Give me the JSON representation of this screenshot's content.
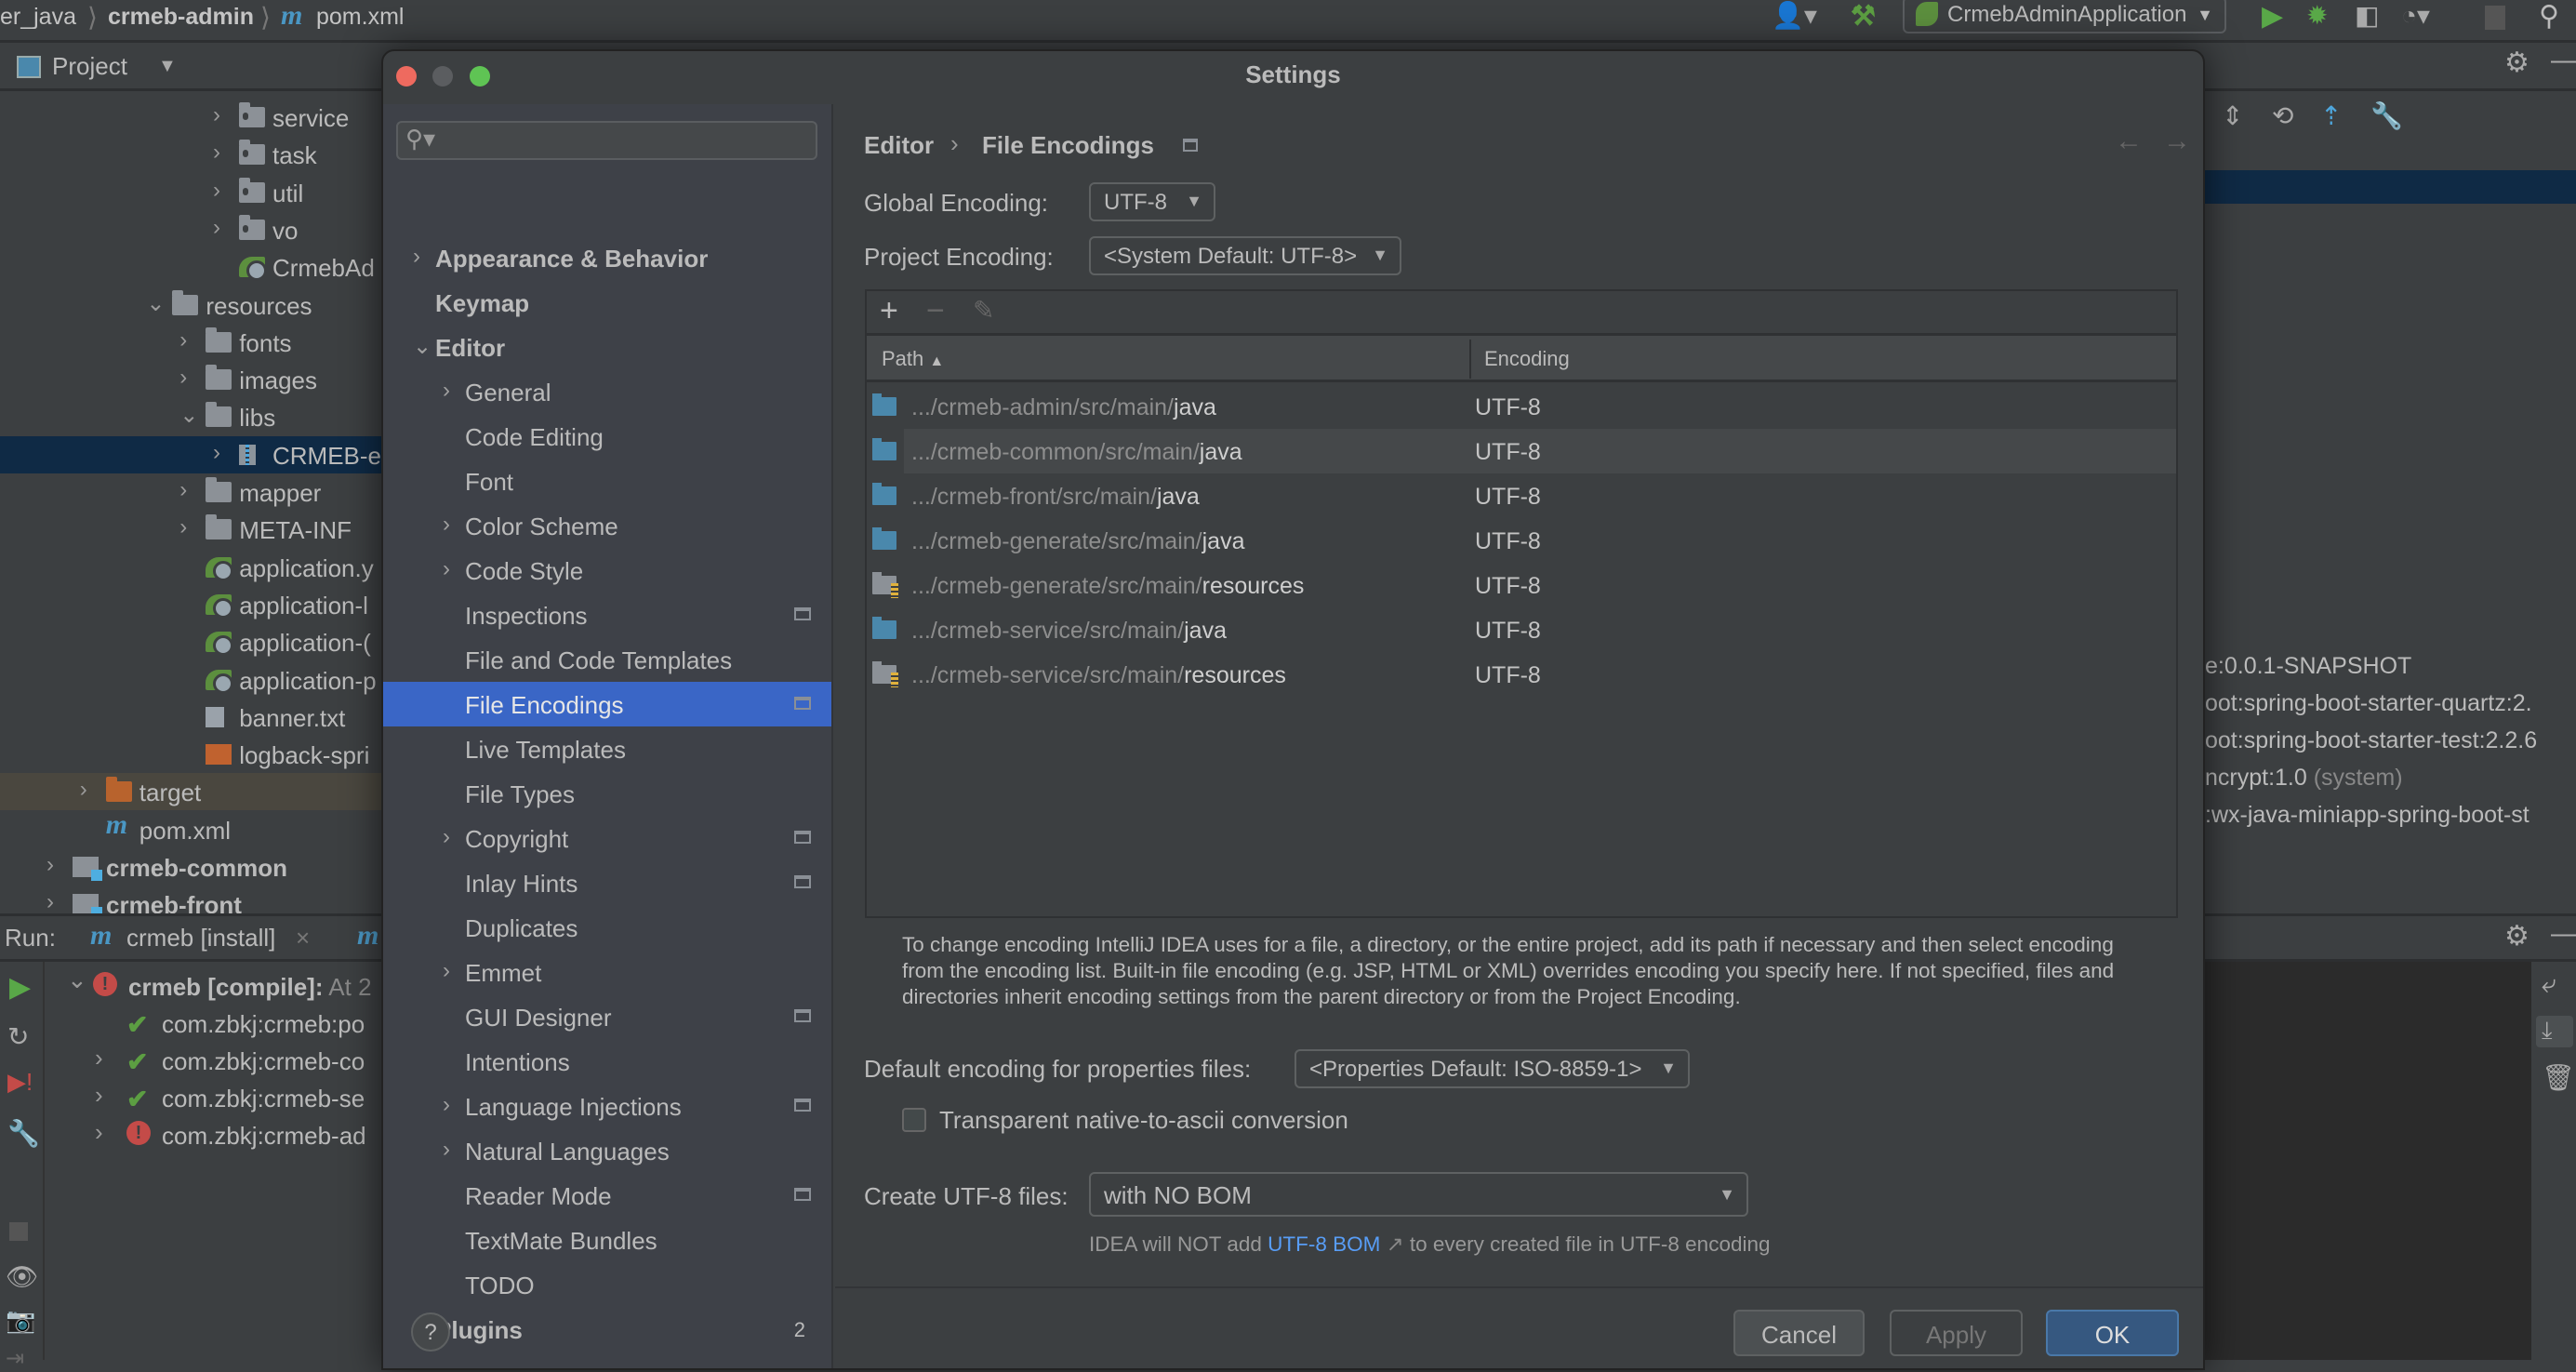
{
  "toolbar": {
    "breadcrumb": [
      "er_java",
      "crmeb-admin",
      "pom.xml"
    ],
    "maven_glyph": "m",
    "run_config": "CrmebAdminApplication",
    "icons": [
      "user-icon",
      "build-hammer-icon",
      "run-icon",
      "debug-icon",
      "coverage-icon",
      "profile-icon",
      "stop-icon",
      "search-icon"
    ]
  },
  "project_panel": {
    "title": "Project",
    "tree": [
      {
        "text": "service",
        "depth": 6,
        "chevron": "right",
        "icon": "package"
      },
      {
        "text": "task",
        "depth": 6,
        "chevron": "right",
        "icon": "package"
      },
      {
        "text": "util",
        "depth": 6,
        "chevron": "right",
        "icon": "package"
      },
      {
        "text": "vo",
        "depth": 6,
        "chevron": "right",
        "icon": "package"
      },
      {
        "text": "CrmebAd",
        "depth": 6,
        "chevron": null,
        "icon": "spring"
      },
      {
        "text": "resources",
        "depth": 4,
        "chevron": "down",
        "icon": "folder"
      },
      {
        "text": "fonts",
        "depth": 5,
        "chevron": "right",
        "icon": "folder"
      },
      {
        "text": "images",
        "depth": 5,
        "chevron": "right",
        "icon": "folder"
      },
      {
        "text": "libs",
        "depth": 5,
        "chevron": "down",
        "icon": "folder"
      },
      {
        "text": "CRMEB-e",
        "depth": 6,
        "chevron": "right",
        "icon": "jar",
        "selected": true
      },
      {
        "text": "mapper",
        "depth": 5,
        "chevron": "right",
        "icon": "folder"
      },
      {
        "text": "META-INF",
        "depth": 5,
        "chevron": "right",
        "icon": "folder"
      },
      {
        "text": "application.y",
        "depth": 5,
        "chevron": null,
        "icon": "spring"
      },
      {
        "text": "application-l",
        "depth": 5,
        "chevron": null,
        "icon": "spring"
      },
      {
        "text": "application-(",
        "depth": 5,
        "chevron": null,
        "icon": "spring"
      },
      {
        "text": "application-p",
        "depth": 5,
        "chevron": null,
        "icon": "spring"
      },
      {
        "text": "banner.txt",
        "depth": 5,
        "chevron": null,
        "icon": "text"
      },
      {
        "text": "logback-spri",
        "depth": 5,
        "chevron": null,
        "icon": "xml"
      },
      {
        "text": "target",
        "depth": 2,
        "chevron": "right",
        "icon": "excluded",
        "excluded": true
      },
      {
        "text": "pom.xml",
        "depth": 2,
        "chevron": null,
        "icon": "maven"
      },
      {
        "text": "crmeb-common",
        "depth": 1,
        "chevron": "right",
        "icon": "module",
        "bold": true
      },
      {
        "text": "crmeb-front",
        "depth": 1,
        "chevron": "right",
        "icon": "module",
        "bold": true
      }
    ]
  },
  "run_panel": {
    "label": "Run:",
    "tab": "crmeb [install]",
    "tab2_glyph": "m",
    "items": [
      {
        "text": "crmeb [compile]:",
        "suffix": "At 2",
        "status": "error",
        "expanded": true,
        "root": true
      },
      {
        "text": "com.zbkj:crmeb:po",
        "status": "ok",
        "chevron": false
      },
      {
        "text": "com.zbkj:crmeb-co",
        "status": "ok",
        "chevron": true
      },
      {
        "text": "com.zbkj:crmeb-se",
        "status": "ok",
        "chevron": true
      },
      {
        "text": "com.zbkj:crmeb-ad",
        "status": "error",
        "chevron": true
      }
    ]
  },
  "editor": {
    "lines": [
      {
        "text": "e:0.0.1-SNAPSHOT"
      },
      {
        "text": "oot:spring-boot-starter-quartz:2."
      },
      {
        "text": "oot:spring-boot-starter-test:2.2.6"
      },
      {
        "text": "ncrypt:1.0",
        "dim": "(system)"
      },
      {
        "text": ":wx-java-miniapp-spring-boot-st"
      }
    ]
  },
  "dialog": {
    "title": "Settings",
    "search_placeholder": "",
    "sidebar": [
      {
        "label": "Appearance & Behavior",
        "depth": 0,
        "chevron": "right",
        "bold": true
      },
      {
        "label": "Keymap",
        "depth": 0,
        "bold": true
      },
      {
        "label": "Editor",
        "depth": 0,
        "chevron": "down",
        "bold": true
      },
      {
        "label": "General",
        "depth": 1,
        "chevron": "right"
      },
      {
        "label": "Code Editing",
        "depth": 1
      },
      {
        "label": "Font",
        "depth": 1
      },
      {
        "label": "Color Scheme",
        "depth": 1,
        "chevron": "right"
      },
      {
        "label": "Code Style",
        "depth": 1,
        "chevron": "right"
      },
      {
        "label": "Inspections",
        "depth": 1,
        "project_icon": true
      },
      {
        "label": "File and Code Templates",
        "depth": 1
      },
      {
        "label": "File Encodings",
        "depth": 1,
        "project_icon": true,
        "selected": true
      },
      {
        "label": "Live Templates",
        "depth": 1
      },
      {
        "label": "File Types",
        "depth": 1
      },
      {
        "label": "Copyright",
        "depth": 1,
        "chevron": "right",
        "project_icon": true
      },
      {
        "label": "Inlay Hints",
        "depth": 1,
        "project_icon": true
      },
      {
        "label": "Duplicates",
        "depth": 1
      },
      {
        "label": "Emmet",
        "depth": 1,
        "chevron": "right"
      },
      {
        "label": "GUI Designer",
        "depth": 1,
        "project_icon": true
      },
      {
        "label": "Intentions",
        "depth": 1
      },
      {
        "label": "Language Injections",
        "depth": 1,
        "chevron": "right",
        "project_icon": true
      },
      {
        "label": "Natural Languages",
        "depth": 1,
        "chevron": "right"
      },
      {
        "label": "Reader Mode",
        "depth": 1,
        "project_icon": true
      },
      {
        "label": "TextMate Bundles",
        "depth": 1
      },
      {
        "label": "TODO",
        "depth": 1
      },
      {
        "label": "Plugins",
        "depth": 0,
        "bold": true,
        "badge": "2"
      }
    ],
    "breadcrumb": {
      "parent": "Editor",
      "current": "File Encodings"
    },
    "global_encoding": {
      "label": "Global Encoding:",
      "value": "UTF-8"
    },
    "project_encoding": {
      "label": "Project Encoding:",
      "value": "<System Default: UTF-8>"
    },
    "table": {
      "columns": [
        "Path",
        "Encoding"
      ],
      "sort": "Path ascending",
      "rows": [
        {
          "prefix": ".../crmeb-admin/src/main/",
          "name": "java",
          "encoding": "UTF-8",
          "icon": "source-folder"
        },
        {
          "prefix": ".../crmeb-common/src/main/",
          "name": "java",
          "encoding": "UTF-8",
          "icon": "source-folder",
          "hovered": true
        },
        {
          "prefix": ".../crmeb-front/src/main/",
          "name": "java",
          "encoding": "UTF-8",
          "icon": "source-folder"
        },
        {
          "prefix": ".../crmeb-generate/src/main/",
          "name": "java",
          "encoding": "UTF-8",
          "icon": "source-folder"
        },
        {
          "prefix": ".../crmeb-generate/src/main/",
          "name": "resources",
          "encoding": "UTF-8",
          "icon": "resource-folder"
        },
        {
          "prefix": ".../crmeb-service/src/main/",
          "name": "java",
          "encoding": "UTF-8",
          "icon": "source-folder"
        },
        {
          "prefix": ".../crmeb-service/src/main/",
          "name": "resources",
          "encoding": "UTF-8",
          "icon": "resource-folder"
        }
      ]
    },
    "help_text": "To change encoding IntelliJ IDEA uses for a file, a directory, or the entire project, add its path if necessary and then select encoding from the encoding list. Built-in file encoding (e.g. JSP, HTML or XML) overrides encoding you specify here. If not specified, files and directories inherit encoding settings from the parent directory or from the Project Encoding.",
    "properties_encoding": {
      "label": "Default encoding for properties files:",
      "value": "<Properties Default: ISO-8859-1>"
    },
    "native_to_ascii": {
      "label": "Transparent native-to-ascii conversion",
      "checked": false
    },
    "create_utf8": {
      "label": "Create UTF-8 files:",
      "value": "with NO BOM"
    },
    "bom_hint": {
      "before": "IDEA will NOT add",
      "link": "UTF-8 BOM",
      "after": "to every created file in UTF-8 encoding"
    },
    "buttons": {
      "help": "?",
      "cancel": "Cancel",
      "apply": "Apply",
      "ok": "OK"
    },
    "colors": {
      "selection": "#3a66c6",
      "ok_button": "#365880",
      "link": "#589df6"
    }
  }
}
